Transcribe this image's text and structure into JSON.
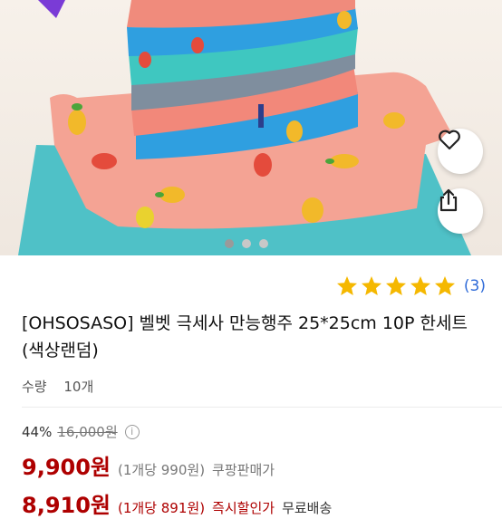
{
  "gallery": {
    "image_alt": "towel stack product photo",
    "pages": 3,
    "active_page": 1
  },
  "actions": {
    "like_icon": "heart-icon",
    "share_icon": "share-icon"
  },
  "rating": {
    "stars": 5,
    "count_text": "(3)",
    "star_color": "#f5b800"
  },
  "product": {
    "title": "[OHSOSASO] 벨벳 극세사 만능행주 25*25cm 10P 한세트(색상랜덤)",
    "qty_label": "수량",
    "qty_value": "10개"
  },
  "pricing": {
    "discount_percent": "44%",
    "original_price": "16,000원",
    "price": "9,900원",
    "unit_price": "(1개당 990원)",
    "seller_label": "쿠팡판매가",
    "price2": "8,910원",
    "unit_price2": "(1개당 891원)",
    "price2_label": "즉시할인가",
    "shipping": "무료배송",
    "accent_color": "#ae0000"
  }
}
